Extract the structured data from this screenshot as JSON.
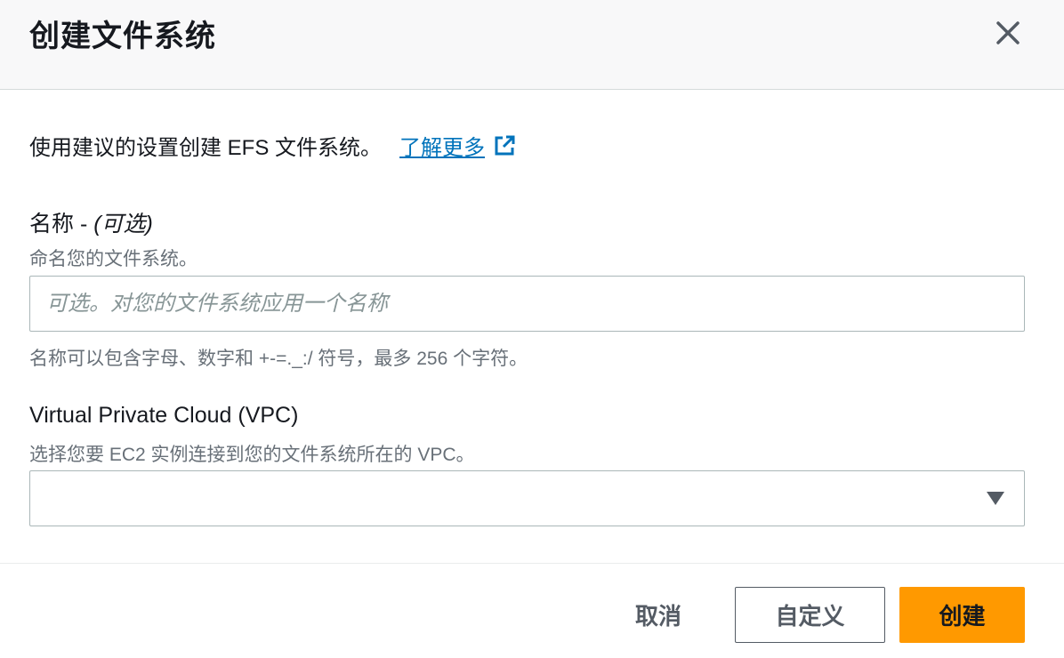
{
  "header": {
    "title": "创建文件系统"
  },
  "intro": {
    "text": "使用建议的设置创建 EFS 文件系统。",
    "link_label": "了解更多"
  },
  "name_field": {
    "label": "名称 - ",
    "optional_label": "(可选)",
    "description": "命名您的文件系统。",
    "value": "",
    "placeholder": "可选。对您的文件系统应用一个名称",
    "constraint": "名称可以包含字母、数字和 +-=._:/ 符号，最多 256 个字符。"
  },
  "vpc_field": {
    "label": "Virtual Private Cloud (VPC)",
    "description": "选择您要 EC2 实例连接到您的文件系统所在的 VPC。",
    "selected_value": ""
  },
  "footer": {
    "cancel_label": "取消",
    "customize_label": "自定义",
    "create_label": "创建"
  },
  "colors": {
    "primary_button": "#ff9900",
    "link": "#0073bb",
    "header_bg": "#f8f8f9"
  }
}
